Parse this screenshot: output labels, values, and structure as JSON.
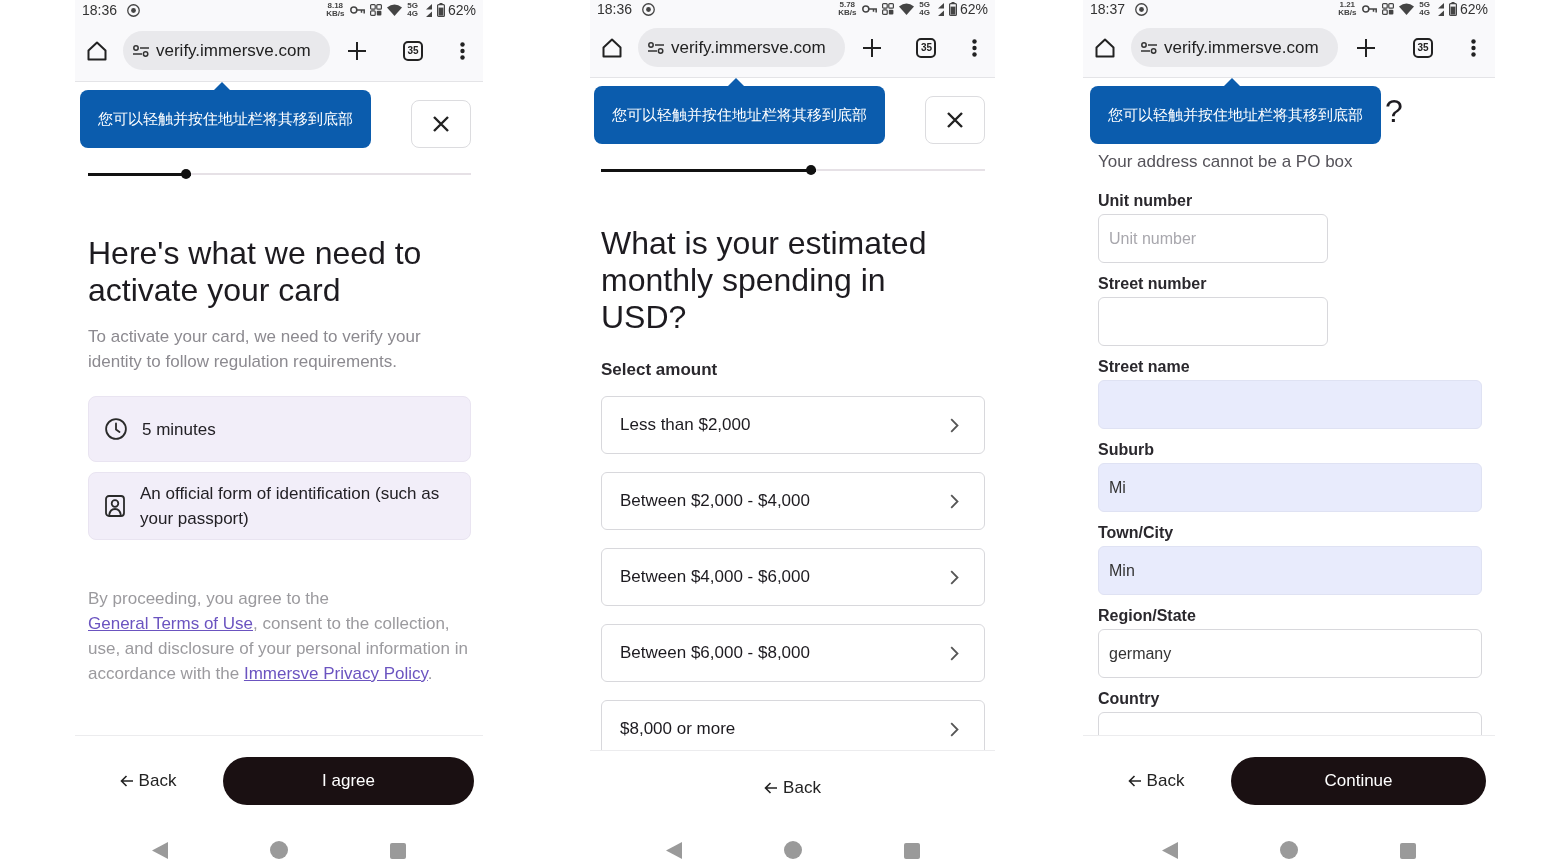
{
  "phones": [
    {
      "kind": "intro",
      "status_bar": {
        "time": "18:36",
        "net_speed": "8.18 KB/s",
        "network": [
          "5G",
          "4G"
        ],
        "battery": "62%"
      },
      "browser": {
        "url": "verify.immersve.com",
        "tab_count": "35"
      },
      "tooltip": "您可以轻触并按住地址栏将其移到底部",
      "show_close": true,
      "progress": {
        "level": 0.27
      },
      "content": {
        "heading": "Here's what we need to activate your card",
        "description": "To activate your card, we need to verify your identity to follow regulation requirements.",
        "requirements": [
          {
            "kind": "clock",
            "text": "5 minutes"
          },
          {
            "kind": "id",
            "text": "An official form of identification (such as your passport)"
          }
        ],
        "consent": [
          {
            "kind": "text",
            "text": "By proceeding, you agree to the "
          },
          {
            "kind": "link",
            "text": "General Terms of Use"
          },
          {
            "kind": "text",
            "text": ", consent to the collection, use, and disclosure of your personal information in accordance with the "
          },
          {
            "kind": "link",
            "text": "Immersve Privacy Policy"
          },
          {
            "kind": "text",
            "text": "."
          }
        ]
      },
      "footer": {
        "back": "Back",
        "primary": "I agree"
      }
    },
    {
      "kind": "amount",
      "status_bar": {
        "time": "18:36",
        "net_speed": "5.78 KB/s",
        "network": [
          "5G",
          "4G"
        ],
        "battery": "62%"
      },
      "browser": {
        "url": "verify.immersve.com",
        "tab_count": "35"
      },
      "tooltip": "您可以轻触并按住地址栏将其移到底部",
      "show_close": true,
      "progress": {
        "level": 0.56
      },
      "content": {
        "heading": "What is your estimated monthly spending in USD?",
        "field_label": "Select amount",
        "options": [
          {
            "label": "Less than $2,000"
          },
          {
            "label": "Between $2,000 - $4,000"
          },
          {
            "label": "Between $4,000 - $6,000"
          },
          {
            "label": "Between $6,000 - $8,000"
          },
          {
            "label": "$8,000 or more"
          }
        ]
      },
      "footer": {
        "back": "Back"
      }
    },
    {
      "kind": "address",
      "status_bar": {
        "time": "18:37",
        "net_speed": "1.21 KB/s",
        "network": [
          "5G",
          "4G"
        ],
        "battery": "62%"
      },
      "browser": {
        "url": "verify.immersve.com",
        "tab_count": "35"
      },
      "tooltip": "您可以轻触并按住地址栏将其移到底部",
      "content": {
        "heading": "?",
        "note": "Your address cannot be a PO box",
        "fields": [
          {
            "label": "Unit number",
            "kind": "half",
            "placeholder": "Unit number",
            "autofilled": false
          },
          {
            "label": "Street number",
            "kind": "half",
            "autofilled": false
          },
          {
            "label": "Street name",
            "kind": "full",
            "autofilled": true
          },
          {
            "label": "Suburb",
            "kind": "full",
            "value": "Mi",
            "autofilled": true
          },
          {
            "label": "Town/City",
            "kind": "full",
            "value": "Min",
            "autofilled": true
          },
          {
            "label": "Region/State",
            "kind": "full",
            "value": "germany",
            "autofilled": false
          },
          {
            "label": "Country",
            "kind": "full",
            "autofilled": false
          }
        ]
      },
      "footer": {
        "back": "Back",
        "primary": "Continue"
      }
    }
  ]
}
